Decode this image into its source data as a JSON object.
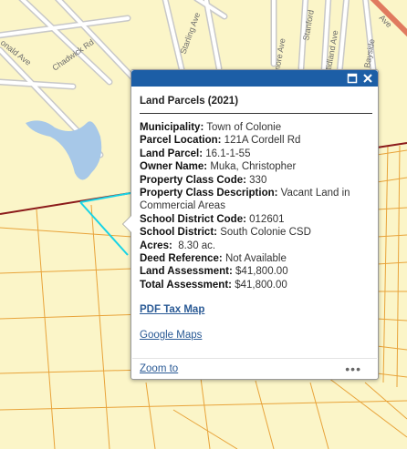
{
  "map": {
    "street_labels": [
      "Chadwick Rd",
      "onald Ave",
      "Starling Ave",
      "Stanford",
      "more Ave",
      "Midland Ave",
      "Bayside",
      "Ave"
    ]
  },
  "popup": {
    "title": "Land Parcels (2021)",
    "fields": [
      {
        "label": "Municipality:",
        "value": "Town of Colonie"
      },
      {
        "label": "Parcel Location:",
        "value": "121A Cordell Rd"
      },
      {
        "label": "Land Parcel:",
        "value": "16.1-1-55"
      },
      {
        "label": "Owner Name:",
        "value": "Muka, Christopher"
      },
      {
        "label": "Property Class Code:",
        "value": "330"
      },
      {
        "label": "Property Class Description:",
        "value": "Vacant Land in Commercial Areas"
      },
      {
        "label": "School District Code:",
        "value": "012601"
      },
      {
        "label": "School District:",
        "value": "South Colonie CSD"
      },
      {
        "label": "Acres:",
        "value": "8.30 ac."
      },
      {
        "label": "Deed Reference:",
        "value": "Not Available"
      },
      {
        "label": "Land Assessment:",
        "value": "$41,800.00"
      },
      {
        "label": "Total Assessment:",
        "value": "$41,800.00"
      }
    ],
    "pdf_link": "PDF Tax Map",
    "google_link": "Google Maps",
    "zoom_link": "Zoom to",
    "more": "•••",
    "maximize_icon": "maximize-icon",
    "close_icon": "close-icon"
  },
  "colors": {
    "header": "#1c5ea6",
    "parcel_line": "#e8a33a",
    "selected_parcel": "#19d4e6",
    "boundary": "#8b1a1a",
    "water": "#a7c8e8",
    "map_bg": "#fbf5c8"
  }
}
